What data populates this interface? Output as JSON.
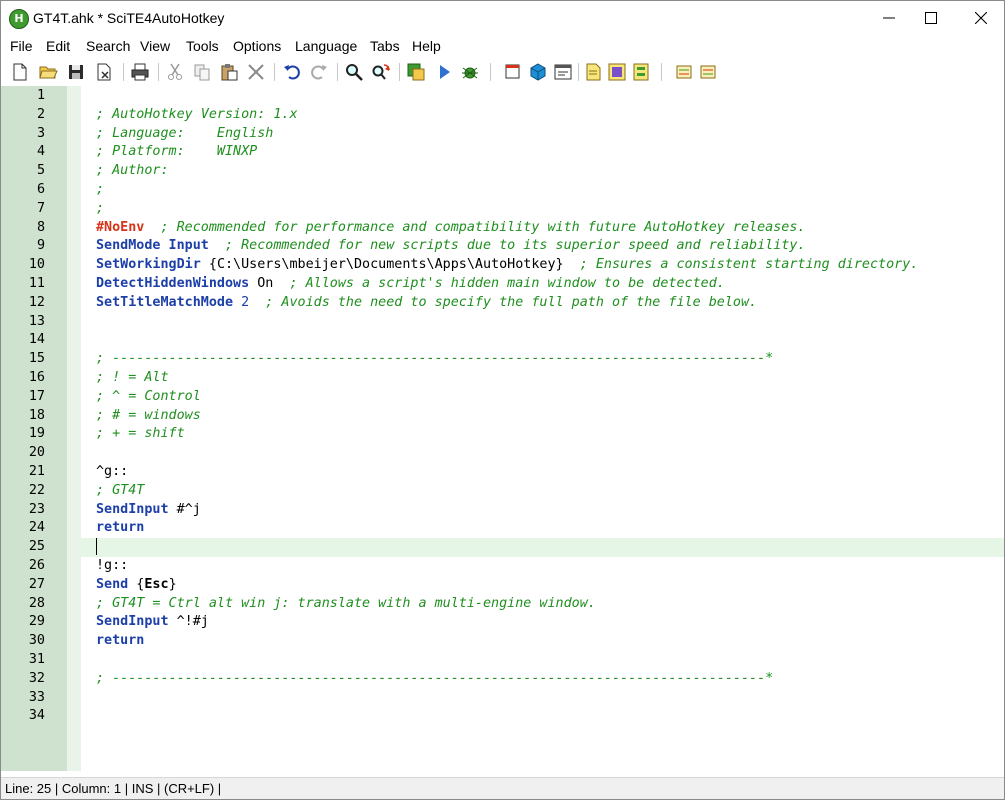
{
  "window": {
    "title": "GT4T.ahk * SciTE4AutoHotkey",
    "app_icon_glyph": "H"
  },
  "menu": [
    "File",
    "Edit",
    "Search",
    "View",
    "Tools",
    "Options",
    "Language",
    "Tabs",
    "Help"
  ],
  "toolbar": {
    "icons": [
      "new-file-icon",
      "open-folder-icon",
      "save-icon",
      "close-file-icon",
      "print-icon",
      "cut-icon",
      "copy-icon",
      "paste-icon",
      "delete-icon",
      "undo-icon",
      "redo-icon",
      "find-icon",
      "replace-icon",
      "compile-icon",
      "run-icon",
      "debug-icon",
      "tool-window-icon",
      "cube-icon",
      "window-spy-icon",
      "notes-icon",
      "help-icon",
      "info-icon",
      "abbrev-icon",
      "user-icon"
    ]
  },
  "editor": {
    "current_line": 25,
    "line_numbers": [
      "1",
      "2",
      "3",
      "4",
      "5",
      "6",
      "7",
      "8",
      "9",
      "10",
      "11",
      "12",
      "13",
      "14",
      "15",
      "16",
      "17",
      "18",
      "19",
      "20",
      "21",
      "22",
      "23",
      "24",
      "25",
      "26",
      "27",
      "28",
      "29",
      "30",
      "31",
      "32",
      "33",
      "34"
    ],
    "lines": [
      [],
      [
        {
          "t": "; AutoHotkey Version: 1.x",
          "c": "comment"
        }
      ],
      [
        {
          "t": "; Language:    English",
          "c": "comment"
        }
      ],
      [
        {
          "t": "; Platform:    WINXP",
          "c": "comment"
        }
      ],
      [
        {
          "t": "; Author:",
          "c": "comment"
        }
      ],
      [
        {
          "t": ";",
          "c": "comment"
        }
      ],
      [
        {
          "t": ";",
          "c": "comment"
        }
      ],
      [
        {
          "t": "#NoEnv",
          "c": "directive"
        },
        {
          "t": "  ; Recommended for performance and compatibility with future AutoHotkey releases.",
          "c": "comment"
        }
      ],
      [
        {
          "t": "SendMode Input",
          "c": "kw"
        },
        {
          "t": "  ; Recommended for new scripts due to its superior speed and reliability.",
          "c": "comment"
        }
      ],
      [
        {
          "t": "SetWorkingDir",
          "c": "kw"
        },
        {
          "t": " {",
          "c": "blk"
        },
        {
          "t": "C:\\Users\\mbeijer\\Documents\\Apps\\AutoHotkey",
          "c": "blk"
        },
        {
          "t": "}",
          "c": "blk"
        },
        {
          "t": "  ; Ensures a consistent starting directory.",
          "c": "comment"
        }
      ],
      [
        {
          "t": "DetectHiddenWindows",
          "c": "kw"
        },
        {
          "t": " On",
          "c": "blk"
        },
        {
          "t": "  ; Allows a script's hidden main window to be detected.",
          "c": "comment"
        }
      ],
      [
        {
          "t": "SetTitleMatchMode",
          "c": "kw"
        },
        {
          "t": " 2",
          "c": "num"
        },
        {
          "t": "  ; Avoids the need to specify the full path of the file below.",
          "c": "comment"
        }
      ],
      [],
      [],
      [
        {
          "t": "; ---------------------------------------------------------------------------------*",
          "c": "comment"
        }
      ],
      [
        {
          "t": "; ! = Alt",
          "c": "comment"
        }
      ],
      [
        {
          "t": "; ^ = Control",
          "c": "comment"
        }
      ],
      [
        {
          "t": "; # = windows",
          "c": "comment"
        }
      ],
      [
        {
          "t": "; + = shift",
          "c": "comment"
        }
      ],
      [],
      [
        {
          "t": "^g::",
          "c": "blk"
        }
      ],
      [
        {
          "t": "; GT4T",
          "c": "comment"
        }
      ],
      [
        {
          "t": "SendInput",
          "c": "kw"
        },
        {
          "t": " #^j",
          "c": "blk"
        }
      ],
      [
        {
          "t": "return",
          "c": "kw"
        }
      ],
      [],
      [
        {
          "t": "!g::",
          "c": "blk"
        }
      ],
      [
        {
          "t": "Send",
          "c": "kw"
        },
        {
          "t": " {",
          "c": "blk"
        },
        {
          "t": "Esc",
          "c": "blkb"
        },
        {
          "t": "}",
          "c": "blk"
        }
      ],
      [
        {
          "t": "; GT4T = Ctrl alt win j: translate with a multi-engine window.",
          "c": "comment"
        }
      ],
      [
        {
          "t": "SendInput",
          "c": "kw"
        },
        {
          "t": " ^!#j",
          "c": "blk"
        }
      ],
      [
        {
          "t": "return",
          "c": "kw"
        }
      ],
      [],
      [
        {
          "t": "; ---------------------------------------------------------------------------------*",
          "c": "comment"
        }
      ],
      [],
      []
    ]
  },
  "status": {
    "text": "Line: 25 | Column: 1 | INS | (CR+LF) |"
  },
  "colors": {
    "gutter": "#cfe2cf",
    "comment": "#1f8f1f",
    "keyword": "#1c3fa8",
    "directive": "#d7321a",
    "caret_line": "#e6f6e6"
  }
}
